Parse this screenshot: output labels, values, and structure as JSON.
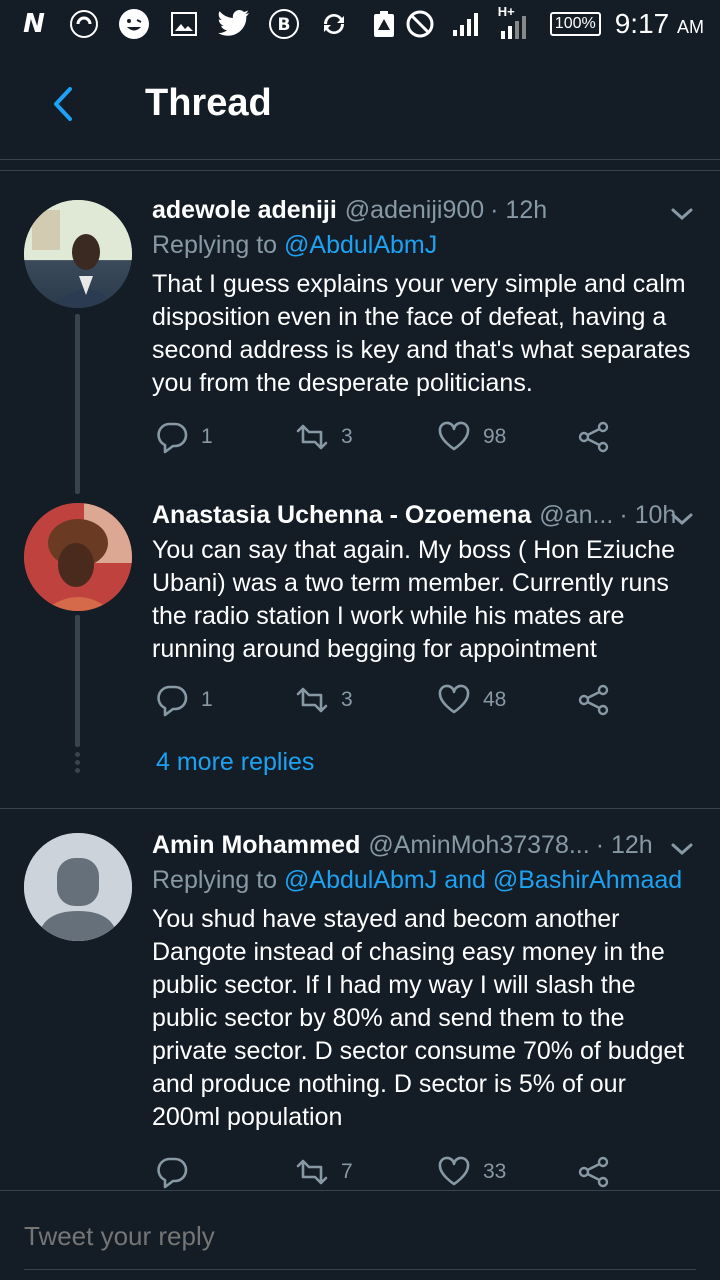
{
  "statusbar": {
    "battery": "100%",
    "time": "9:17",
    "ampm": "AM",
    "network": "H+"
  },
  "header": {
    "title": "Thread"
  },
  "tweets": [
    {
      "name": "adewole adeniji",
      "handle": "@adeniji900",
      "time": "· 12h",
      "replying_prefix": "Replying to",
      "replying_to": "@AbdulAbmJ",
      "text": "That I guess explains your very simple and calm disposition even in the face of defeat, having a second address is key and that's what separates you from the desperate politicians.",
      "replies": "1",
      "retweets": "3",
      "likes": "98"
    },
    {
      "name": "Anastasia Uchenna - Ozoemena",
      "handle": "@an...",
      "time": "· 10h",
      "text": "You can say that again. My boss ( Hon Eziuche Ubani)  was a two term member. Currently runs the radio station I work while his mates are running around begging for appointment",
      "replies": "1",
      "retweets": "3",
      "likes": "48"
    },
    {
      "name": "Amin Mohammed",
      "handle": "@AminMoh37378...",
      "time": "· 12h",
      "replying_prefix": "Replying to",
      "replying_to": "@AbdulAbmJ and @BashirAhmaad",
      "text": "You shud have stayed and becom another Dangote instead of chasing easy money in the public sector. If I had my way I will slash the public sector by 80% and send them to the private sector. D sector consume 70% of budget and produce nothing. D sector is 5% of our 200ml population",
      "replies": "",
      "retweets": "7",
      "likes": "33"
    }
  ],
  "more_replies": "4 more replies",
  "reply_bar": {
    "placeholder": "Tweet your reply"
  },
  "colors": {
    "background": "#141d26",
    "accent": "#1da1f2",
    "muted": "#8899a6",
    "border": "#38444d"
  }
}
